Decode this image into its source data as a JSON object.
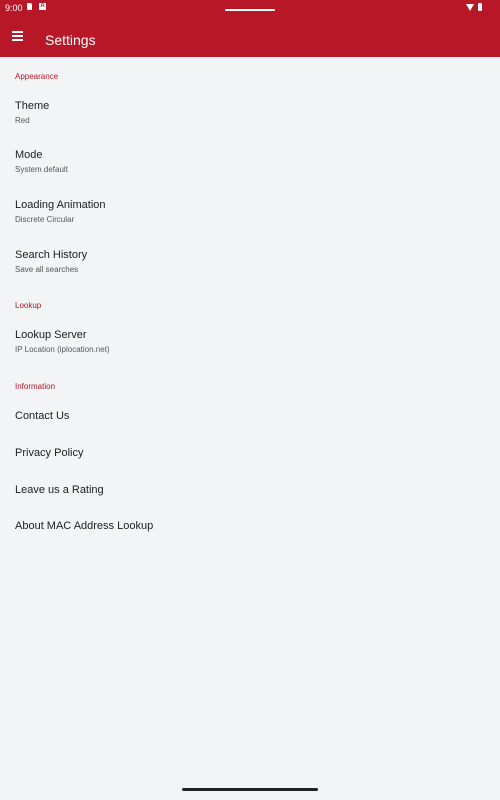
{
  "status_bar": {
    "time": "9:00",
    "a_icon_text": "A",
    "icons": [
      "sim-card-icon",
      "accessibility-a-icon",
      "wifi-icon",
      "battery-icon"
    ]
  },
  "app_bar": {
    "title": "Settings",
    "menu_icon": "hamburger-menu-icon"
  },
  "sections": {
    "appearance": {
      "header": "Appearance",
      "theme": {
        "title": "Theme",
        "value": "Red"
      },
      "mode": {
        "title": "Mode",
        "value": "System default"
      },
      "loading_animation": {
        "title": "Loading Animation",
        "value": "Discrete Circular"
      },
      "search_history": {
        "title": "Search History",
        "value": "Save all searches"
      }
    },
    "lookup": {
      "header": "Lookup",
      "lookup_server": {
        "title": "Lookup Server",
        "value": "IP Location (iplocation.net)"
      }
    },
    "information": {
      "header": "Information",
      "contact": "Contact Us",
      "privacy": "Privacy Policy",
      "rating": "Leave us a Rating",
      "about": "About MAC Address Lookup"
    }
  },
  "colors": {
    "accent": "#b71727",
    "background": "#f3f4f6",
    "text": "#1d1d1f",
    "secondary_text": "#575757"
  }
}
